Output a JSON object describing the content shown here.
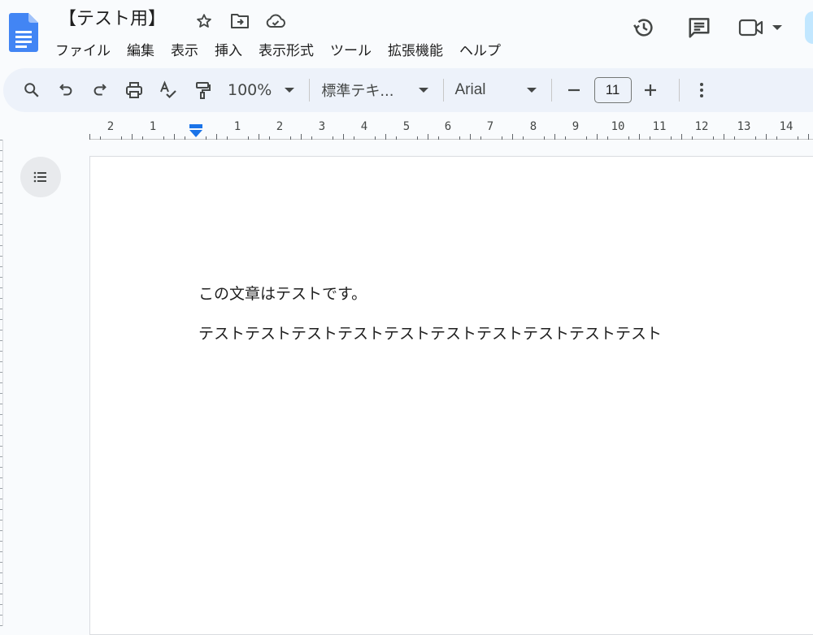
{
  "document": {
    "title": "【テスト用】"
  },
  "menu": {
    "items": [
      "ファイル",
      "編集",
      "表示",
      "挿入",
      "表示形式",
      "ツール",
      "拡張機能",
      "ヘルプ"
    ]
  },
  "title_icons": [
    "star-icon",
    "move-to-folder-icon",
    "cloud-saved-icon"
  ],
  "top_right": [
    "version-history-icon",
    "comments-icon",
    "meet-icon"
  ],
  "toolbar": {
    "zoom": "100%",
    "style": "標準テキ...",
    "font": "Arial",
    "font_size": "11"
  },
  "ruler": {
    "labels": [
      "2",
      "1",
      "1",
      "2",
      "3",
      "4",
      "5",
      "6",
      "7",
      "8",
      "9",
      "10",
      "11",
      "12",
      "13",
      "14"
    ]
  },
  "body": {
    "paragraphs": [
      "この文章はテストです。",
      "テストテストテストテストテストテストテストテストテストテスト"
    ]
  },
  "colors": {
    "accent": "#1a73e8",
    "toolbar_bg": "#edf2fa",
    "page_bg": "#ffffff",
    "app_bg": "#f9fbfd"
  }
}
